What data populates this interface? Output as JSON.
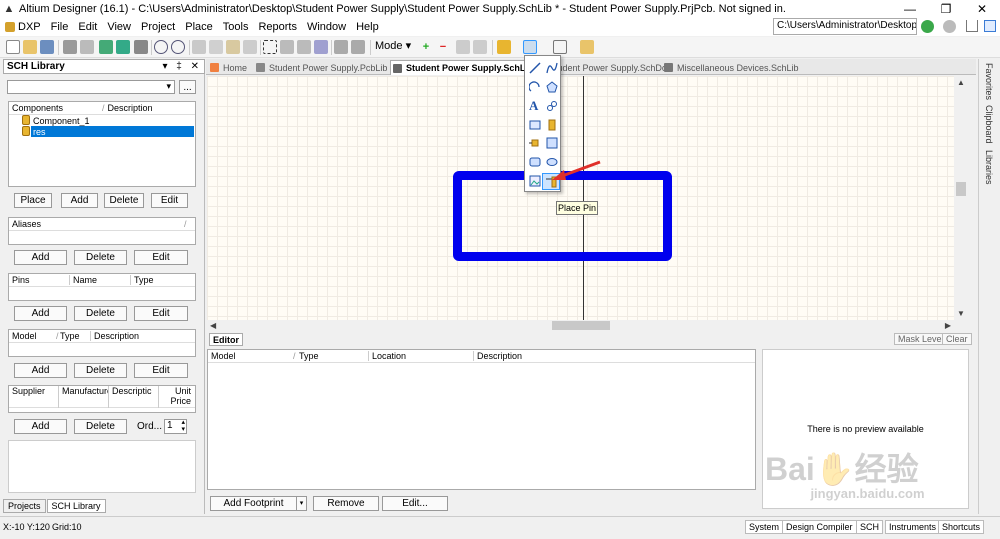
{
  "window": {
    "title": "Altium Designer (16.1) - C:\\Users\\Administrator\\Desktop\\Student Power Supply\\Student Power Supply.SchLib * - Student Power Supply.PrjPcb. Not signed in.",
    "controls": [
      "—",
      "❐",
      "✕"
    ]
  },
  "menu": {
    "items": [
      "DXP",
      "File",
      "Edit",
      "View",
      "Project",
      "Place",
      "Tools",
      "Reports",
      "Window",
      "Help"
    ],
    "path": "C:\\Users\\Administrator\\Desktop\\"
  },
  "toolbar": {
    "mode_label": "Mode ▾"
  },
  "left_panel": {
    "title": "SCH Library",
    "pin_glyphs": "▾ ‡ ✕",
    "filter_placeholder": "",
    "filter_btn": "...",
    "components": {
      "headers": [
        "Components",
        "Description"
      ],
      "items": [
        "Component_1",
        "res"
      ],
      "selected_index": 1,
      "buttons": [
        "Place",
        "Add",
        "Delete",
        "Edit"
      ]
    },
    "aliases": {
      "header": "Aliases",
      "buttons": [
        "Add",
        "Delete",
        "Edit"
      ]
    },
    "pins": {
      "headers": [
        "Pins",
        "Name",
        "Type"
      ],
      "buttons": [
        "Add",
        "Delete",
        "Edit"
      ]
    },
    "model": {
      "headers": [
        "Model",
        "Type",
        "Description"
      ],
      "buttons": [
        "Add",
        "Delete",
        "Edit"
      ]
    },
    "supplier": {
      "headers": [
        "Supplier",
        "Manufacture",
        "Descriptic",
        "Unit Price"
      ],
      "buttons": [
        "Add",
        "Delete"
      ],
      "order_label": "Ord...",
      "order_value": "1"
    },
    "tabs": [
      "Projects",
      "SCH Library"
    ]
  },
  "doc_tabs": [
    {
      "label": "Home"
    },
    {
      "label": "Student Power Supply.PcbLib *"
    },
    {
      "label": "Student Power Supply.SchLib *"
    },
    {
      "label": "Student Power Supply.SchDoc"
    },
    {
      "label": "Miscellaneous Devices.SchLib"
    }
  ],
  "popup": {
    "tooltip": "Place Pin",
    "text_glyph": "A"
  },
  "editor": {
    "tab": "Editor",
    "mask_level": "Mask Level",
    "clear": "Clear",
    "headers": [
      "Model",
      "Type",
      "Location",
      "Description"
    ],
    "buttons": {
      "add_footprint": "Add Footprint",
      "remove": "Remove",
      "edit": "Edit..."
    },
    "preview_text": "There is no preview available"
  },
  "right_tabs": [
    "Favorites",
    "Clipboard",
    "Libraries"
  ],
  "status": {
    "coords": "X:-10 Y:120",
    "grid": "Grid:10",
    "buttons": [
      "System",
      "Design Compiler",
      "SCH",
      "Instruments",
      "Shortcuts"
    ]
  },
  "watermark": {
    "line1": "Bai✋经验",
    "line2": "jingyan.baidu.com"
  },
  "colors": {
    "canvas_bg": "#fffcf5",
    "rectangle_stroke": "#0000ee",
    "selection": "#0078d7",
    "tooltip_bg": "#ffffe1"
  }
}
